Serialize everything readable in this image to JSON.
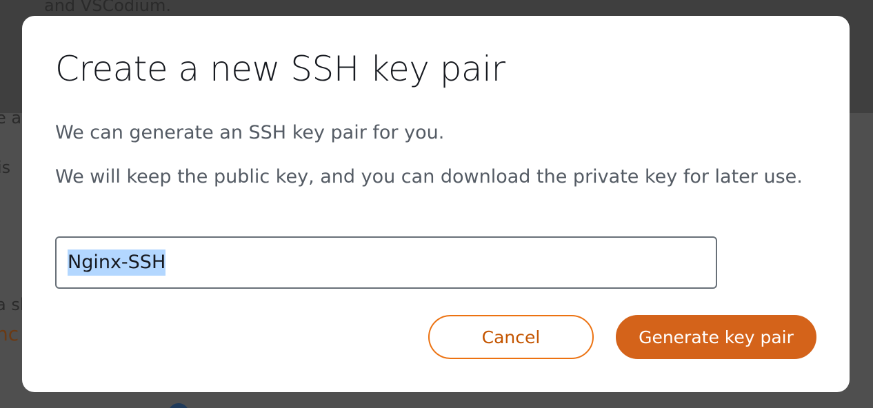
{
  "background": {
    "top_text": "and VSCodium.",
    "fragments": [
      "e a",
      "is",
      "a sl",
      "nc"
    ]
  },
  "modal": {
    "title": "Create a new SSH key pair",
    "paragraph_1": "We can generate an SSH key pair for you.",
    "paragraph_2": "We will keep the public key, and you can download the private key for later use.",
    "key_name_input": {
      "value": "Nginx-SSH",
      "selected": true
    },
    "cancel_label": "Cancel",
    "generate_label": "Generate key pair"
  },
  "colors": {
    "accent": "#ec7211",
    "primary_button": "#d4631a",
    "selection": "#b3d7ff",
    "overlay": "#4a4a4a"
  }
}
